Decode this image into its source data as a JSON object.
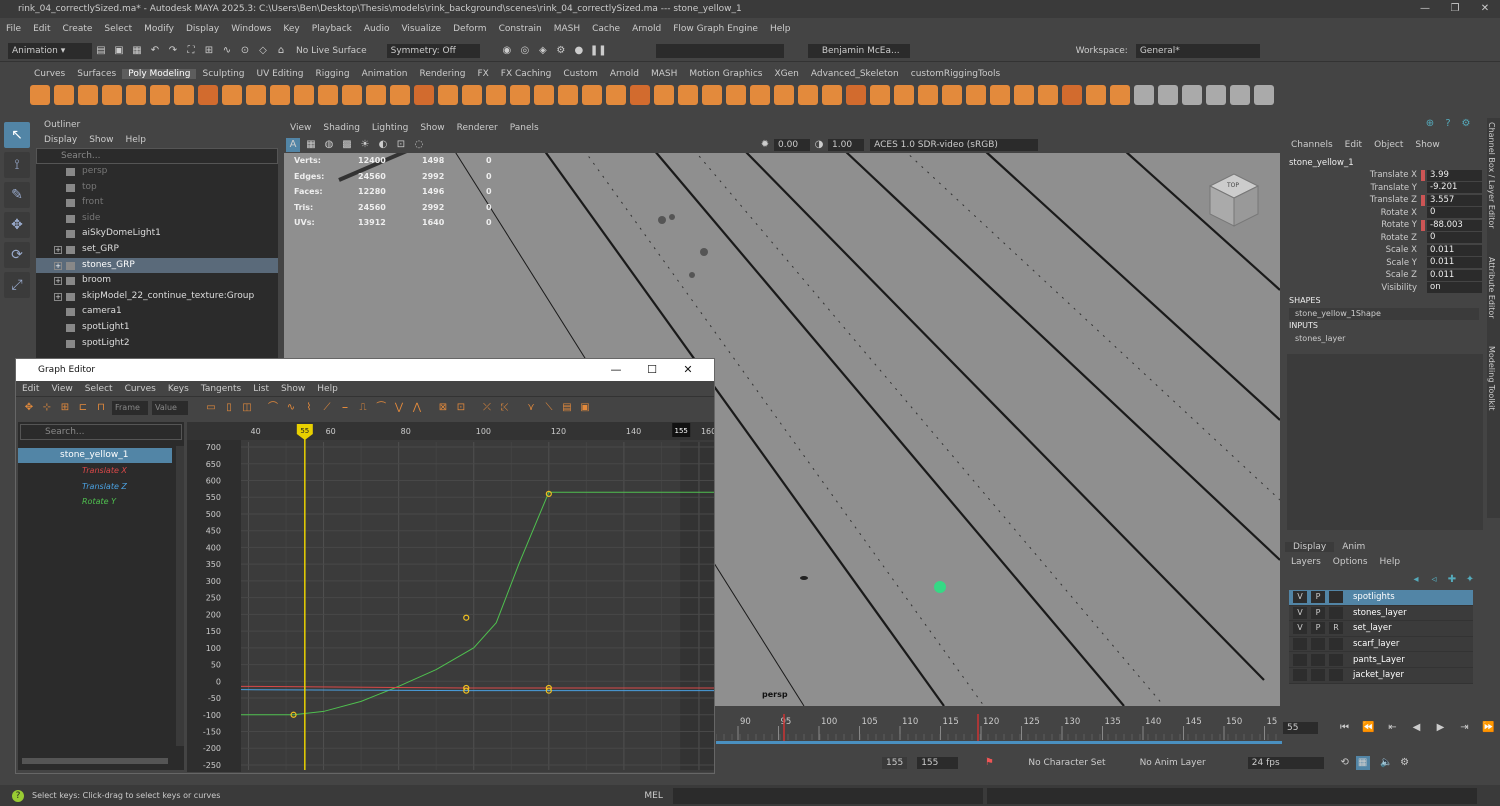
{
  "title_bar": {
    "text": "rink_04_correctlySized.ma* - Autodesk MAYA 2025.3: C:\\Users\\Ben\\Desktop\\Thesis\\models\\rink_background\\scenes\\rink_04_correctlySized.ma   ---   stone_yellow_1"
  },
  "menu": {
    "items": [
      "File",
      "Edit",
      "Create",
      "Select",
      "Modify",
      "Display",
      "Windows",
      "Key",
      "Playback",
      "Audio",
      "Visualize",
      "Deform",
      "Constrain",
      "MASH",
      "Cache",
      "Arnold",
      "Flow Graph Engine",
      "Help"
    ],
    "workspace_label": "Workspace:",
    "workspace_value": "General*"
  },
  "status": {
    "menuset": "Animation",
    "live_surface": "No Live Surface",
    "symmetry": "Symmetry: Off",
    "user": "Benjamin McEa..."
  },
  "shelf": {
    "tabs": [
      "Curves",
      "Surfaces",
      "Poly Modeling",
      "Sculpting",
      "UV Editing",
      "Rigging",
      "Animation",
      "Rendering",
      "FX",
      "FX Caching",
      "Custom",
      "Arnold",
      "MASH",
      "Motion Graphics",
      "XGen",
      "Advanced_Skeleton",
      "customRiggingTools"
    ],
    "active": "Poly Modeling"
  },
  "outliner": {
    "header": "Outliner",
    "menu": [
      "Display",
      "Show",
      "Help"
    ],
    "search_placeholder": "Search...",
    "items": [
      {
        "label": "persp",
        "dim": true
      },
      {
        "label": "top",
        "dim": true
      },
      {
        "label": "front",
        "dim": true
      },
      {
        "label": "side",
        "dim": true
      },
      {
        "label": "aiSkyDomeLight1"
      },
      {
        "label": "set_GRP",
        "exp": true
      },
      {
        "label": "stones_GRP",
        "exp": true,
        "sel": true
      },
      {
        "label": "broom",
        "exp": true
      },
      {
        "label": "skipModel_22_continue_texture:Group",
        "exp": true
      },
      {
        "label": "camera1"
      },
      {
        "label": "spotLight1"
      },
      {
        "label": "spotLight2"
      }
    ]
  },
  "viewport": {
    "menu": [
      "View",
      "Shading",
      "Lighting",
      "Show",
      "Renderer",
      "Panels"
    ],
    "exposure": "0.00",
    "gamma": "1.00",
    "colorspace": "ACES 1.0 SDR-video (sRGB)",
    "camera_label": "persp",
    "cube_label": "TOP",
    "hud": [
      [
        "Verts:",
        "12400",
        "1498",
        "0"
      ],
      [
        "Edges:",
        "24560",
        "2992",
        "0"
      ],
      [
        "Faces:",
        "12280",
        "1496",
        "0"
      ],
      [
        "Tris:",
        "24560",
        "2992",
        "0"
      ],
      [
        "UVs:",
        "13912",
        "1640",
        "0"
      ]
    ]
  },
  "graph_editor": {
    "title": "Graph Editor",
    "menu": [
      "Edit",
      "View",
      "Select",
      "Curves",
      "Keys",
      "Tangents",
      "List",
      "Show",
      "Help"
    ],
    "frame_placeholder": "Frame",
    "value_placeholder": "Value",
    "search_placeholder": "Search...",
    "object": "stone_yellow_1",
    "channels": [
      {
        "label": "Translate X",
        "color": "#d94848"
      },
      {
        "label": "Translate Z",
        "color": "#4aa0e0"
      },
      {
        "label": "Rotate Y",
        "color": "#4fc04f"
      }
    ]
  },
  "chart_data": {
    "type": "line",
    "x_ticks": [
      40,
      60,
      80,
      100,
      120,
      140,
      160
    ],
    "y_ticks": [
      700,
      650,
      600,
      550,
      500,
      450,
      400,
      350,
      300,
      250,
      200,
      150,
      100,
      50,
      0,
      -50,
      -100,
      -150,
      -200,
      -250
    ],
    "xlim": [
      38,
      164
    ],
    "ylim": [
      -265,
      715
    ],
    "current_frame": 55,
    "end_frame": 155,
    "end_frame_label": "155",
    "series": [
      {
        "name": "Rotate Y",
        "color": "#4fc04f",
        "x": [
          38,
          52,
          60,
          70,
          80,
          90,
          100,
          106,
          112,
          120,
          164
        ],
        "y": [
          -100,
          -100,
          -90,
          -60,
          -15,
          35,
          100,
          175,
          350,
          565,
          565
        ],
        "keys": [
          [
            52,
            -100
          ],
          [
            98,
            190
          ],
          [
            120,
            560
          ]
        ]
      },
      {
        "name": "Translate X",
        "color": "#d94848",
        "x": [
          38,
          98,
          120,
          164
        ],
        "y": [
          -15,
          -20,
          -20,
          -20
        ],
        "keys": [
          [
            98,
            -20
          ],
          [
            120,
            -20
          ]
        ]
      },
      {
        "name": "Translate Z",
        "color": "#4aa0e0",
        "x": [
          38,
          98,
          120,
          164
        ],
        "y": [
          -25,
          -28,
          -28,
          -28
        ],
        "keys": [
          [
            98,
            -28
          ],
          [
            120,
            -28
          ]
        ]
      }
    ]
  },
  "channel_box": {
    "menu": [
      "Channels",
      "Edit",
      "Object",
      "Show"
    ],
    "object": "stone_yellow_1",
    "attrs": [
      [
        "Translate X",
        "3.99",
        true
      ],
      [
        "Translate Y",
        "-9.201",
        false
      ],
      [
        "Translate Z",
        "3.557",
        true
      ],
      [
        "Rotate X",
        "0",
        false
      ],
      [
        "Rotate Y",
        "-88.003",
        true
      ],
      [
        "Rotate Z",
        "0",
        false
      ],
      [
        "Scale X",
        "0.011",
        false
      ],
      [
        "Scale Y",
        "0.011",
        false
      ],
      [
        "Scale Z",
        "0.011",
        false
      ],
      [
        "Visibility",
        "on",
        false
      ]
    ],
    "shapes_header": "SHAPES",
    "shape": "stone_yellow_1Shape",
    "inputs_header": "INPUTS",
    "input": "stones_layer"
  },
  "layers": {
    "tabs": [
      "Display",
      "Anim"
    ],
    "menu": [
      "Layers",
      "Options",
      "Help"
    ],
    "items": [
      {
        "v": "V",
        "p": "P",
        "r": "",
        "name": "spotlights",
        "sel": true
      },
      {
        "v": "V",
        "p": "P",
        "r": "",
        "name": "stones_layer"
      },
      {
        "v": "V",
        "p": "P",
        "r": "R",
        "name": "set_layer"
      },
      {
        "v": "",
        "p": "",
        "r": "",
        "name": "scarf_layer"
      },
      {
        "v": "",
        "p": "",
        "r": "",
        "name": "pants_Layer"
      },
      {
        "v": "",
        "p": "",
        "r": "",
        "name": "jacket_layer"
      }
    ]
  },
  "side_tabs": [
    "Channel Box / Layer Editor",
    "Attribute Editor",
    "Modeling Toolkit"
  ],
  "timeline": {
    "ticks": [
      "90",
      "95",
      "100",
      "105",
      "110",
      "115",
      "120",
      "125",
      "130",
      "135",
      "140",
      "145",
      "150",
      "15"
    ],
    "current": "55",
    "range_end": "155",
    "range_end2": "155",
    "character_set": "No Character Set",
    "anim_layer": "No Anim Layer",
    "fps": "24 fps"
  },
  "help_line": {
    "text": "Select keys: Click-drag to select keys or curves",
    "mel": "MEL"
  }
}
